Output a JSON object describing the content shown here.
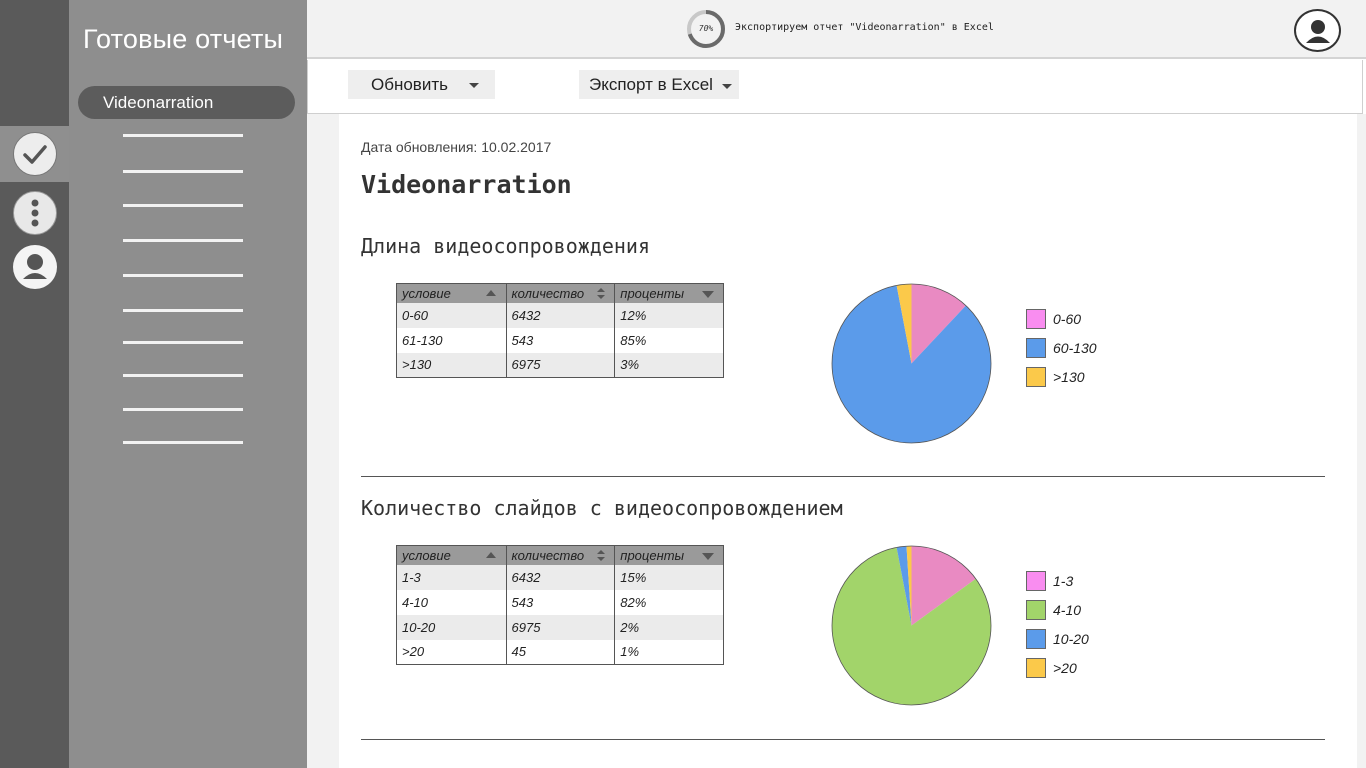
{
  "sidebar": {
    "title": "Готовые отчеты",
    "active_item": "Videonarration"
  },
  "rail": {
    "icons": [
      "check-icon",
      "more-vertical-icon",
      "user-icon"
    ]
  },
  "status": {
    "progress_label": "70%",
    "progress_value": 70,
    "message": "Экспортируем отчет \"Videonarration\" в Excel"
  },
  "toolbar": {
    "refresh_label": "Обновить",
    "export_label": "Экспорт в Excel"
  },
  "report": {
    "updated": "Дата обновления: 10.02.2017",
    "title": "Videonarration"
  },
  "sections": [
    {
      "title": "Длина видеосопровождения",
      "table": {
        "headers": [
          "условие",
          "количество",
          "проценты"
        ],
        "rows": [
          [
            "0-60",
            "6432",
            "12%"
          ],
          [
            "61-130",
            "543",
            "85%"
          ],
          [
            ">130",
            "6975",
            "3%"
          ]
        ]
      },
      "legend": [
        "0-60",
        "60-130",
        ">130"
      ]
    },
    {
      "title": "Количество слайдов с видеосопровождением",
      "table": {
        "headers": [
          "условие",
          "количество",
          "проценты"
        ],
        "rows": [
          [
            "1-3",
            "6432",
            "15%"
          ],
          [
            "4-10",
            "543",
            "82%"
          ],
          [
            "10-20",
            "6975",
            "2%"
          ],
          [
            ">20",
            "45",
            "1%"
          ]
        ]
      },
      "legend": [
        "1-3",
        "4-10",
        "10-20",
        ">20"
      ]
    }
  ],
  "chart_data": [
    {
      "type": "pie",
      "categories": [
        "0-60",
        "60-130",
        ">130"
      ],
      "values": [
        12,
        85,
        3
      ],
      "colors": [
        "#e98ac2",
        "#5b9bea",
        "#fbc94a"
      ],
      "legend_colors": [
        "#f98df0",
        "#5b9bea",
        "#fbc94a"
      ],
      "legend_position": "right"
    },
    {
      "type": "pie",
      "categories": [
        "1-3",
        "4-10",
        "10-20",
        ">20"
      ],
      "values": [
        15,
        82,
        2,
        1
      ],
      "colors": [
        "#e98ac2",
        "#a2d46a",
        "#5b9bea",
        "#fbc94a"
      ],
      "legend_colors": [
        "#f98df0",
        "#a2d46a",
        "#5b9bea",
        "#fbc94a"
      ],
      "legend_position": "right"
    }
  ]
}
